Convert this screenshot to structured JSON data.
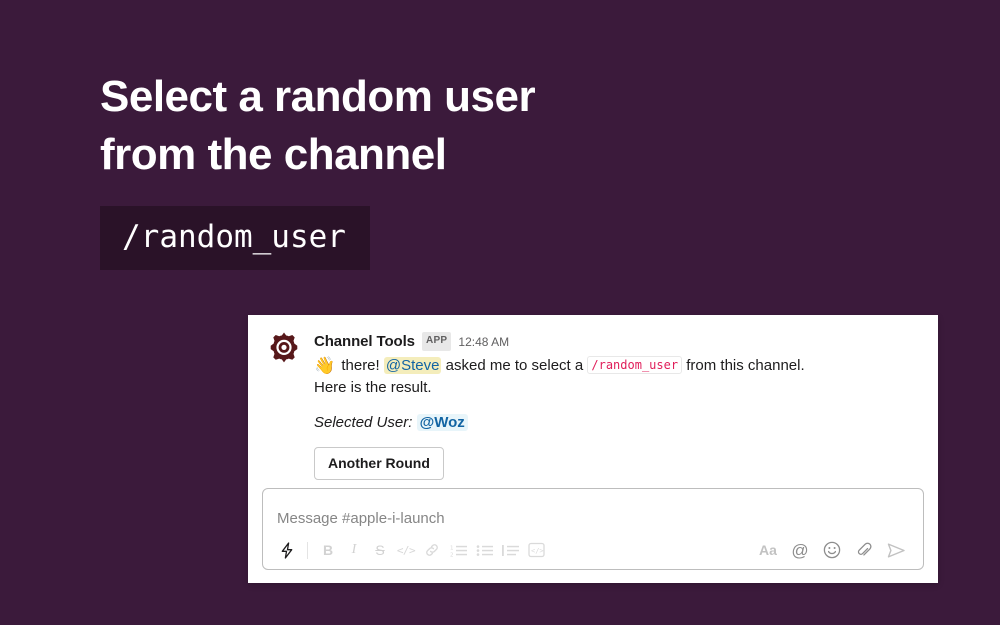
{
  "theme": {
    "background": "#3B1A3B",
    "badge_background": "#2A1228",
    "card_background": "#FFFFFF",
    "mention_link": "#1264A3",
    "code_pink": "#E01E5A"
  },
  "hero": {
    "title": "Select a random user\nfrom the channel",
    "command": "/random_user"
  },
  "slack": {
    "message": {
      "avatar_icon": "gear-icon",
      "sender": "Channel Tools",
      "app_badge": "APP",
      "timestamp": "12:48 AM",
      "wave_emoji": "👋",
      "text_part_1": " there! ",
      "mention_steve": "@Steve",
      "text_part_2": " asked me to select a ",
      "code_command": "/random_user",
      "text_part_3": " from this channel.",
      "text_line_2": "Here is the result.",
      "selected_label": "Selected User:",
      "selected_user": "@Woz",
      "action_button": "Another Round"
    },
    "composer": {
      "placeholder": "Message #apple-i-launch",
      "toolbar_left": [
        {
          "name": "lightning-bolt-icon",
          "label": ""
        },
        {
          "name": "bold-icon",
          "label": "B"
        },
        {
          "name": "italic-icon",
          "label": "I"
        },
        {
          "name": "strikethrough-icon",
          "label": "S"
        },
        {
          "name": "inline-code-icon",
          "label": "</>"
        },
        {
          "name": "link-icon",
          "label": ""
        },
        {
          "name": "ordered-list-icon",
          "label": ""
        },
        {
          "name": "bulleted-list-icon",
          "label": ""
        },
        {
          "name": "blockquote-icon",
          "label": ""
        },
        {
          "name": "code-block-icon",
          "label": ""
        }
      ],
      "toolbar_right": [
        {
          "name": "formatting-icon",
          "label": "Aa"
        },
        {
          "name": "mention-icon",
          "label": "@"
        },
        {
          "name": "emoji-icon",
          "label": ""
        },
        {
          "name": "attachment-icon",
          "label": ""
        },
        {
          "name": "send-icon",
          "label": ""
        }
      ]
    }
  }
}
